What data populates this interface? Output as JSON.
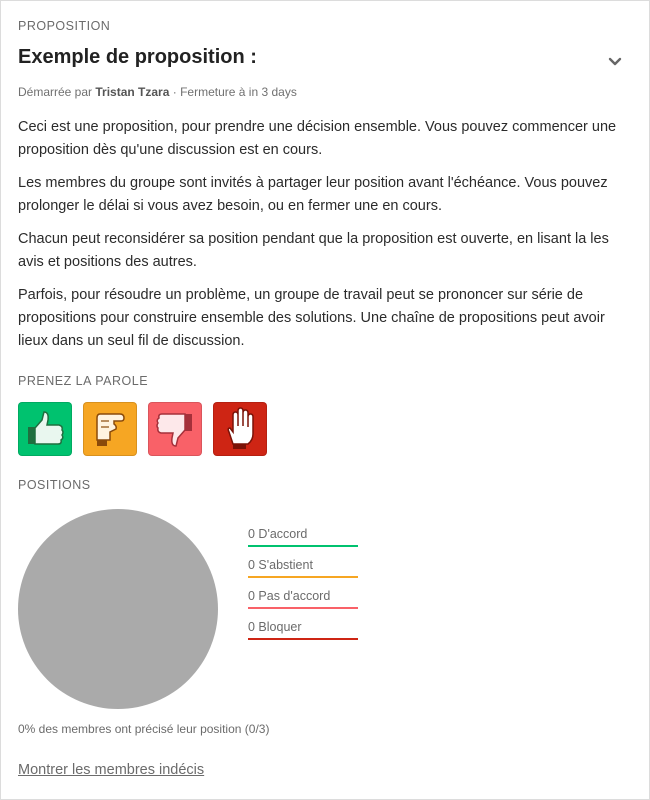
{
  "card": {
    "eyebrow": "PROPOSITION",
    "title": "Exemple de proposition :",
    "meta": {
      "started_by_label": "Démarrée par",
      "author": "Tristan Tzara",
      "separator": "·",
      "closing": "Fermeture à in 3 days"
    },
    "description": [
      "Ceci est une proposition, pour prendre une décision ensemble. Vous pouvez commencer une proposition dès qu'une discussion est en cours.",
      "Les membres du groupe sont invités à partager leur position avant l'échéance. Vous pouvez prolonger le délai si vous avez besoin, ou en fermer une en cours.",
      "Chacun peut reconsidérer sa position pendant que la proposition est ouverte, en lisant la les avis et positions des autres.",
      "Parfois, pour résoudre un problème, un groupe de travail peut se prononcer sur série de propositions pour construire ensemble des solutions. Une chaîne de propositions peut avoir lieux dans un seul fil de discussion."
    ]
  },
  "vote_section": {
    "label": "PRENEZ LA PAROLE",
    "buttons": [
      {
        "icon": "thumbs-up-icon",
        "color": "#00c26f"
      },
      {
        "icon": "abstain-hand-icon",
        "color": "#f6a623"
      },
      {
        "icon": "thumbs-down-icon",
        "color": "#f96168"
      },
      {
        "icon": "block-hand-icon",
        "color": "#ce2514"
      }
    ]
  },
  "positions": {
    "label": "POSITIONS",
    "pie_color": "#aaaaaa",
    "legend": [
      {
        "label": "0 D'accord",
        "color": "#00c26f"
      },
      {
        "label": "0 S'abstient",
        "color": "#f6a623"
      },
      {
        "label": "0 Pas d'accord",
        "color": "#f96168"
      },
      {
        "label": "0 Bloquer",
        "color": "#ce2514"
      }
    ],
    "summary": "0% des membres ont précisé leur position (0/3)",
    "show_undecided_link": "Montrer les membres indécis"
  }
}
